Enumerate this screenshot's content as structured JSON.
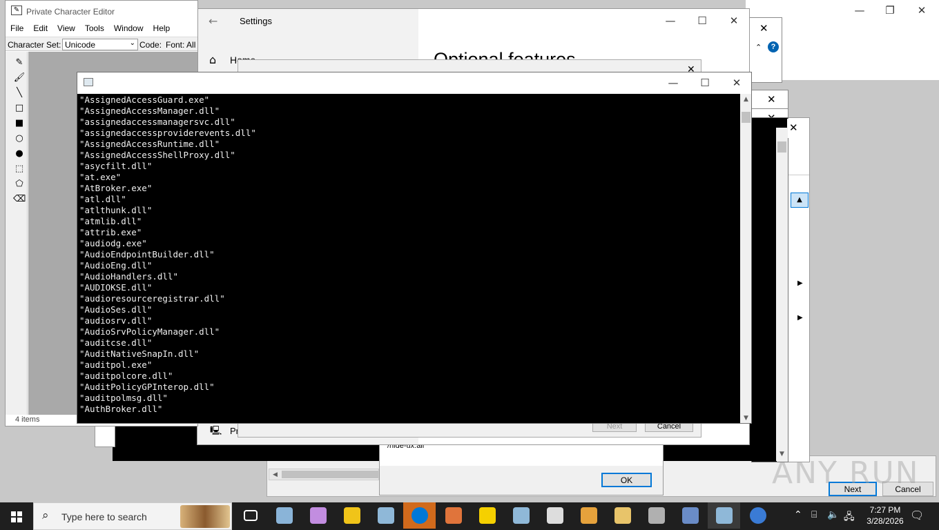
{
  "desktop": {
    "watermark": "ANY RUN"
  },
  "pce": {
    "title": "Private Character Editor",
    "menu": [
      "File",
      "Edit",
      "View",
      "Tools",
      "Window",
      "Help"
    ],
    "charset_label": "Character Set:",
    "charset_value": "Unicode",
    "code_label": "Code:",
    "font_label": "Font: All",
    "status": "4 items"
  },
  "settings": {
    "title": "Settings",
    "home_label": "Home",
    "heading": "Optional features",
    "bottom_label": "Pr",
    "next_label": "Next",
    "cancel_label": "Cancel"
  },
  "msgbox": {
    "cmd_text": "/hide-ux:all",
    "ok_label": "OK"
  },
  "wizard": {
    "next_label": "Next",
    "cancel_label": "Cancel"
  },
  "console": {
    "lines": [
      "\"AssignedAccessGuard.exe\"",
      "\"AssignedAccessManager.dll\"",
      "\"assignedaccessmanagersvc.dll\"",
      "\"assignedaccessproviderevents.dll\"",
      "\"AssignedAccessRuntime.dll\"",
      "\"AssignedAccessShellProxy.dll\"",
      "\"asycfilt.dll\"",
      "\"at.exe\"",
      "\"AtBroker.exe\"",
      "\"atl.dll\"",
      "\"atlthunk.dll\"",
      "\"atmlib.dll\"",
      "\"attrib.exe\"",
      "\"audiodg.exe\"",
      "\"AudioEndpointBuilder.dll\"",
      "\"AudioEng.dll\"",
      "\"AudioHandlers.dll\"",
      "\"AUDIOKSE.dll\"",
      "\"audioresourceregistrar.dll\"",
      "\"AudioSes.dll\"",
      "\"audiosrv.dll\"",
      "\"AudioSrvPolicyManager.dll\"",
      "\"auditcse.dll\"",
      "\"AuditNativeSnapIn.dll\"",
      "\"auditpol.exe\"",
      "\"auditpolcore.dll\"",
      "\"AuditPolicyGPInterop.dll\"",
      "\"auditpolmsg.dll\"",
      "\"AuthBroker.dll\""
    ]
  },
  "taskbar": {
    "search_placeholder": "Type here to search",
    "time": "7:27 PM",
    "date": "3/28/2026",
    "colors": {
      "taskbar_bg": "#1f1f1f",
      "active_tab": "#3a3a3a",
      "highlight": "#0078d7",
      "orange_app": "#d16a1c"
    },
    "apps": [
      {
        "name": "task-view-icon"
      },
      {
        "name": "app-globe-icon"
      },
      {
        "name": "app-cubes-icon"
      },
      {
        "name": "app-hand-icon"
      },
      {
        "name": "app-console-icon"
      },
      {
        "name": "app-info-icon"
      },
      {
        "name": "app-media-icon"
      },
      {
        "name": "app-x-icon"
      },
      {
        "name": "app-console-2-icon"
      },
      {
        "name": "app-pen-icon"
      },
      {
        "name": "app-tools-icon"
      },
      {
        "name": "app-folder-icon"
      },
      {
        "name": "app-files-icon"
      },
      {
        "name": "app-shape-icon"
      },
      {
        "name": "app-console-3-icon"
      },
      {
        "name": "bluetooth-icon"
      }
    ]
  }
}
